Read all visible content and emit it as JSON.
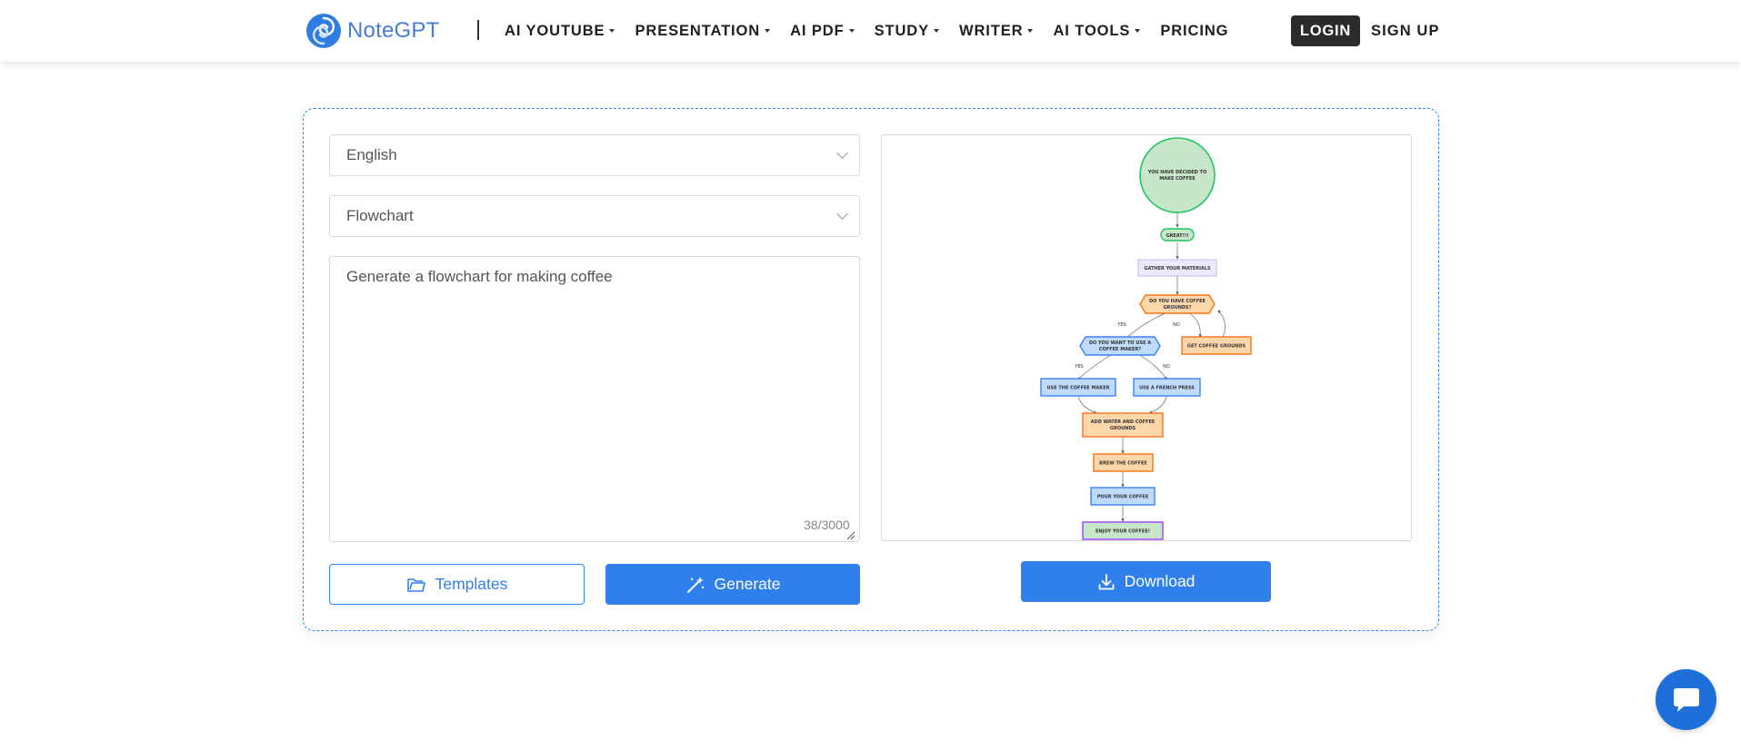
{
  "header": {
    "logo_text": "NoteGPT",
    "nav": [
      {
        "label": "AI YOUTUBE",
        "dropdown": true
      },
      {
        "label": "PRESENTATION",
        "dropdown": true
      },
      {
        "label": "AI PDF",
        "dropdown": true
      },
      {
        "label": "STUDY",
        "dropdown": true
      },
      {
        "label": "WRITER",
        "dropdown": true
      },
      {
        "label": "AI TOOLS",
        "dropdown": true
      },
      {
        "label": "PRICING",
        "dropdown": false
      }
    ],
    "login_label": "LOGIN",
    "signup_label": "SIGN UP"
  },
  "form": {
    "language": "English",
    "diagram_type": "Flowchart",
    "prompt": "Generate a flowchart for making coffee",
    "char_count": "38/3000",
    "templates_label": "Templates",
    "generate_label": "Generate"
  },
  "preview": {
    "download_label": "Download",
    "flowchart": {
      "start": "YOU HAVE DECIDED TO MAKE COFFEE",
      "great": "GREAT!!!",
      "gather": "GATHER YOUR MATERIALS",
      "q_grounds": "DO YOU HAVE COFFEE GROUNDS?",
      "yes1": "YES",
      "no1": "NO",
      "get_grounds": "GET COFFEE GROUNDS",
      "q_maker": "DO YOU WANT TO USE A COFFEE MAKER?",
      "yes2": "YES",
      "no2": "NO",
      "use_maker": "USE THE COFFEE MAKER",
      "use_press": "USE A FRENCH PRESS",
      "add_water": "ADD WATER AND COFFEE GROUNDS",
      "brew": "BREW THE COFFEE",
      "pour": "POUR YOUR COFFEE",
      "enjoy": "ENJOY YOUR COFFEE!"
    }
  },
  "colors": {
    "brand": "#2f80ed",
    "start_fill": "#c8e6c9",
    "start_stroke": "#22c55e",
    "blue_fill": "#bfdbfe",
    "blue_stroke": "#3b82f6",
    "orange_fill": "#fed7aa",
    "orange_stroke": "#f97316",
    "purple_stroke": "#a855f7"
  }
}
